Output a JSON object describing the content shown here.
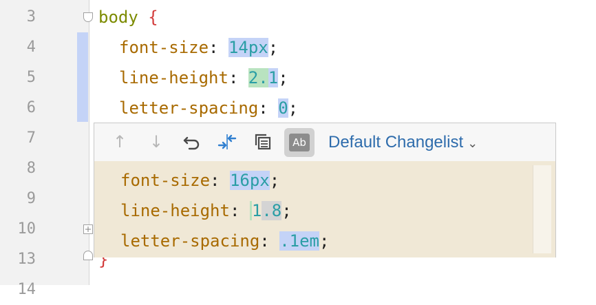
{
  "gutter": {
    "line_numbers": [
      "3",
      "4",
      "5",
      "6",
      "7",
      "8",
      "9",
      "10",
      "13",
      "14"
    ]
  },
  "code": {
    "line3": {
      "selector": "body",
      "open": "{"
    },
    "line4": {
      "prop": "font-size",
      "colon": ": ",
      "value": "14px",
      "semi": ";"
    },
    "line5": {
      "prop": "line-height",
      "colon": ": ",
      "value_a": "2.",
      "value_b": "1",
      "semi": ";"
    },
    "line6": {
      "prop": "letter-spacing",
      "colon": ": ",
      "value": "0",
      "semi": ";"
    },
    "line13": {
      "close": "}"
    }
  },
  "popup": {
    "toolbar": {
      "prev_icon": "arrow-up-icon",
      "next_icon": "arrow-down-icon",
      "rollback_icon": "rollback-icon",
      "compare_icon": "compare-arrows-icon",
      "copy_icon": "copy-icon",
      "ab_label": "Ab",
      "changelist_label": "Default Changelist",
      "changelist_chevron": "⌄"
    },
    "diff": {
      "line1": {
        "prop": "font-size",
        "colon": ": ",
        "value": "16px",
        "semi": ";"
      },
      "line2": {
        "prop": "line-height",
        "colon": ": ",
        "value_a": "1",
        "value_b": ".8",
        "semi": ";"
      },
      "line3": {
        "prop": "letter-spacing",
        "colon": ": ",
        "value": ".1em",
        "semi": ";"
      }
    }
  },
  "colors": {
    "change_marker": "#c4d3f7",
    "diff_background": "#f0e8d6",
    "changelist_link": "#2e6cac"
  }
}
